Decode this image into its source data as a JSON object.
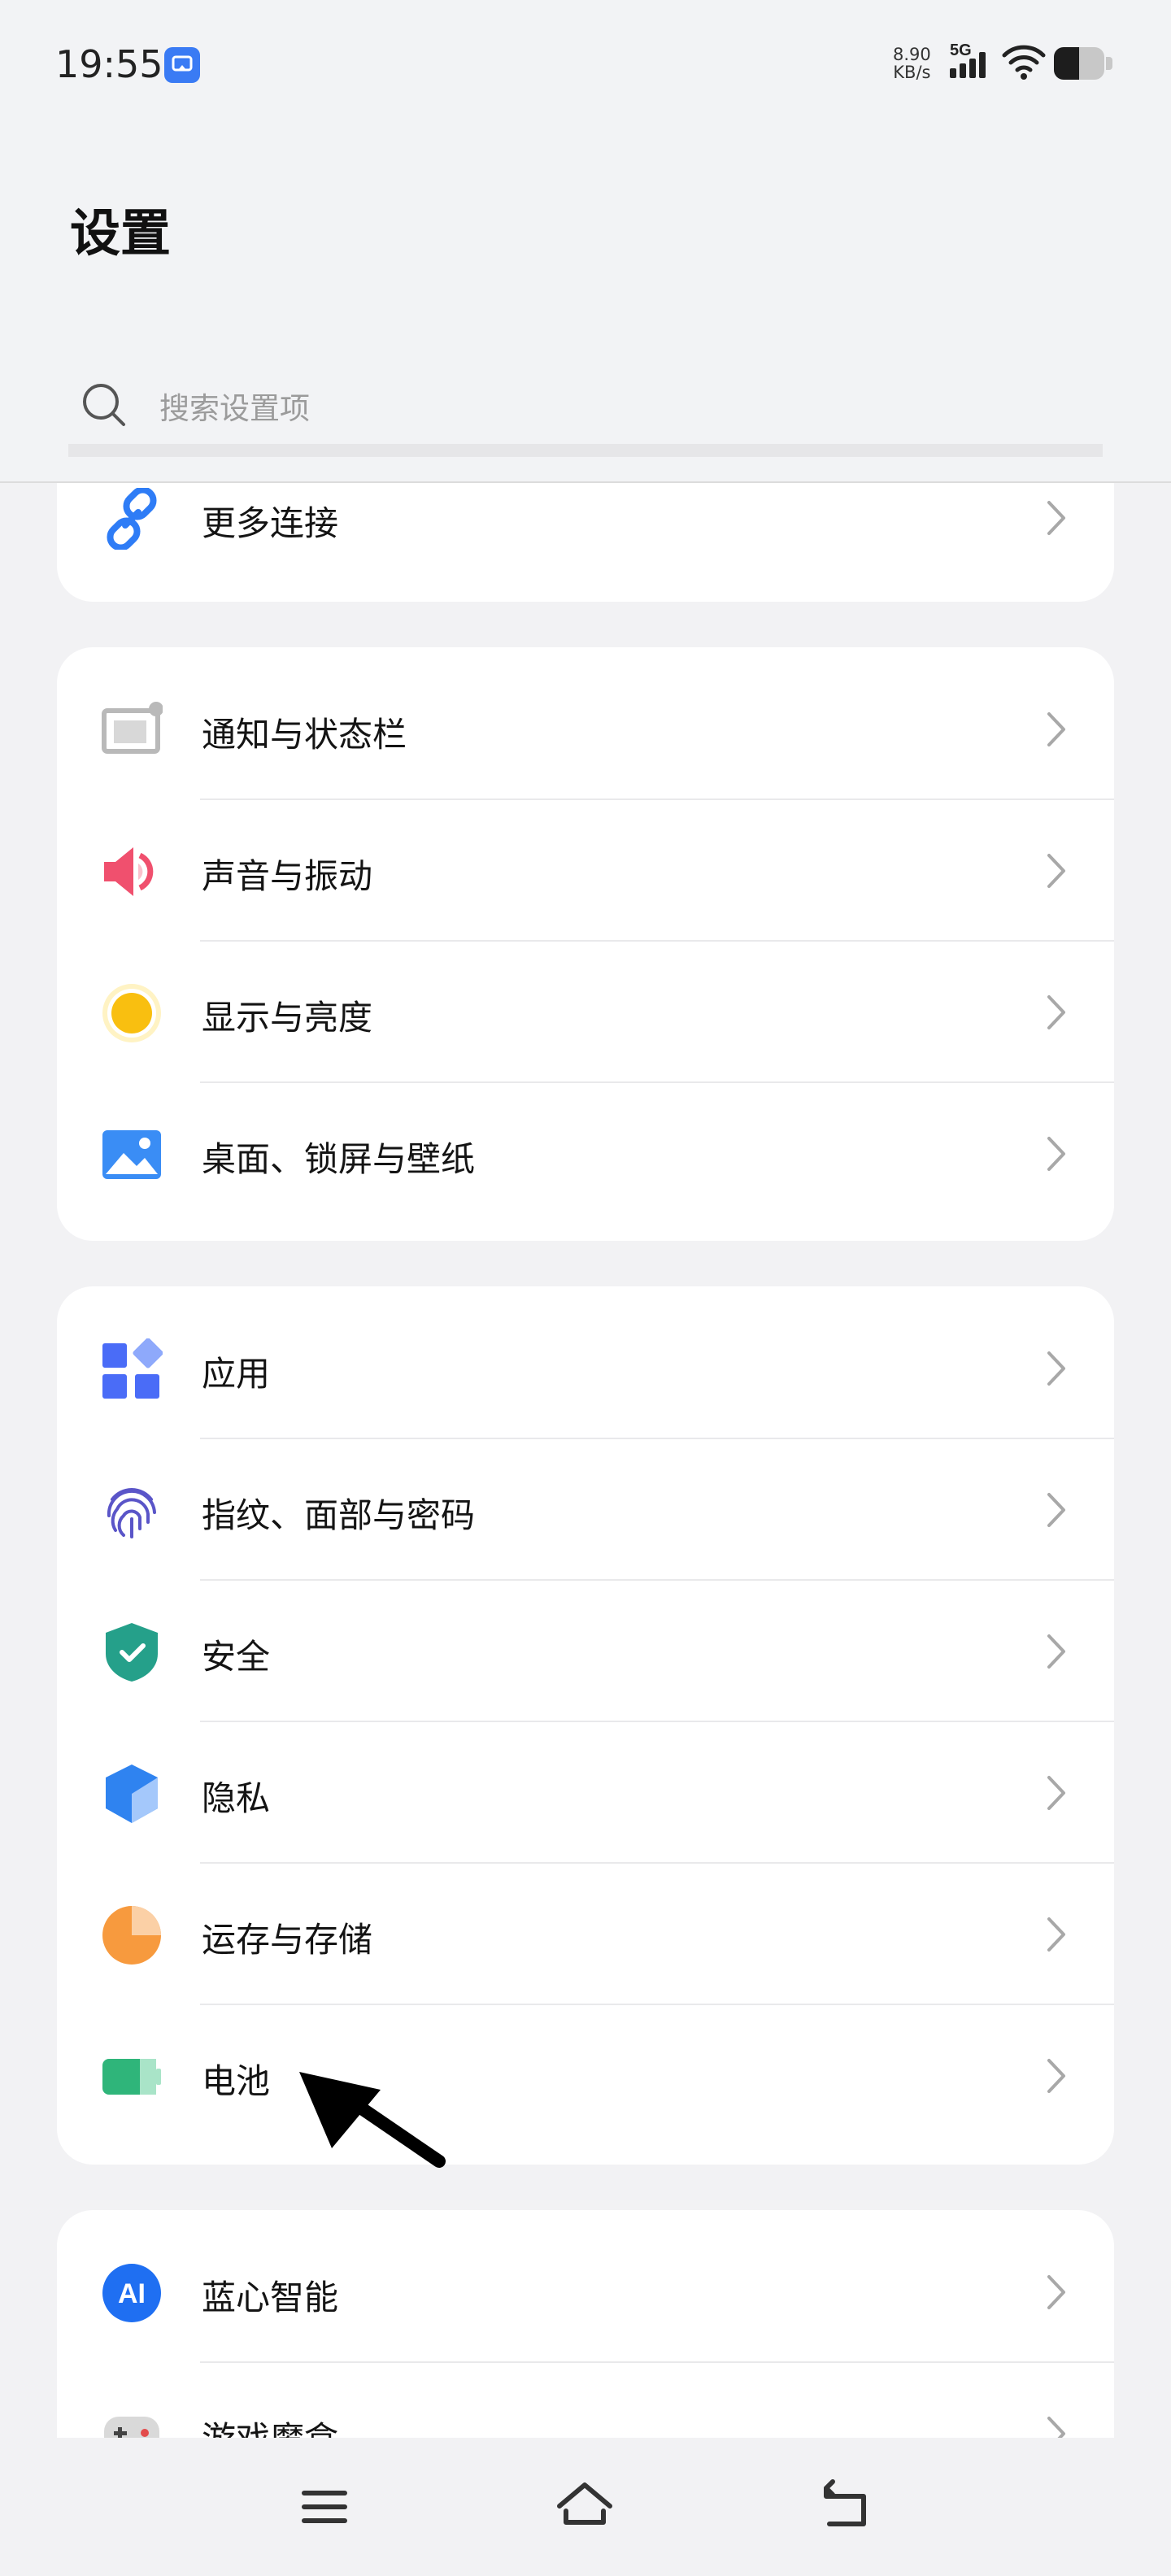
{
  "status_bar": {
    "time": "19:55",
    "net_speed_value": "8.90",
    "net_speed_unit": "KB/s",
    "network": "5G",
    "battery_level": 0.5,
    "icons": [
      "screen-cast-icon",
      "signal-5g-icon",
      "wifi-icon",
      "battery-icon"
    ]
  },
  "header": {
    "title": "设置",
    "search_placeholder": "搜索设置项"
  },
  "groups": [
    {
      "items": [
        {
          "label": "更多连接",
          "icon": "link-icon"
        }
      ]
    },
    {
      "items": [
        {
          "label": "通知与状态栏",
          "icon": "notification-icon"
        },
        {
          "label": "声音与振动",
          "icon": "speaker-icon"
        },
        {
          "label": "显示与亮度",
          "icon": "brightness-icon"
        },
        {
          "label": "桌面、锁屏与壁纸",
          "icon": "wallpaper-icon"
        }
      ]
    },
    {
      "items": [
        {
          "label": "应用",
          "icon": "apps-icon"
        },
        {
          "label": "指纹、面部与密码",
          "icon": "fingerprint-icon"
        },
        {
          "label": "安全",
          "icon": "shield-icon"
        },
        {
          "label": "隐私",
          "icon": "privacy-cube-icon"
        },
        {
          "label": "运存与存储",
          "icon": "storage-pie-icon"
        },
        {
          "label": "电池",
          "icon": "battery-icon"
        }
      ]
    },
    {
      "items": [
        {
          "label": "蓝心智能",
          "icon": "ai-icon"
        },
        {
          "label": "游戏魔盒",
          "icon": "gamepad-icon"
        }
      ]
    }
  ],
  "colors": {
    "accent_blue": "#3a7bf4",
    "sound_red": "#f0506e",
    "display_yellow": "#f9bf10",
    "security_green": "#25a08a",
    "storage_orange": "#f79a3e",
    "battery_green": "#2fb57a"
  },
  "nav_bar": {
    "icons": [
      "menu-icon",
      "home-icon",
      "back-icon"
    ]
  },
  "annotation": {
    "icon": "pointer-arrow-icon"
  }
}
